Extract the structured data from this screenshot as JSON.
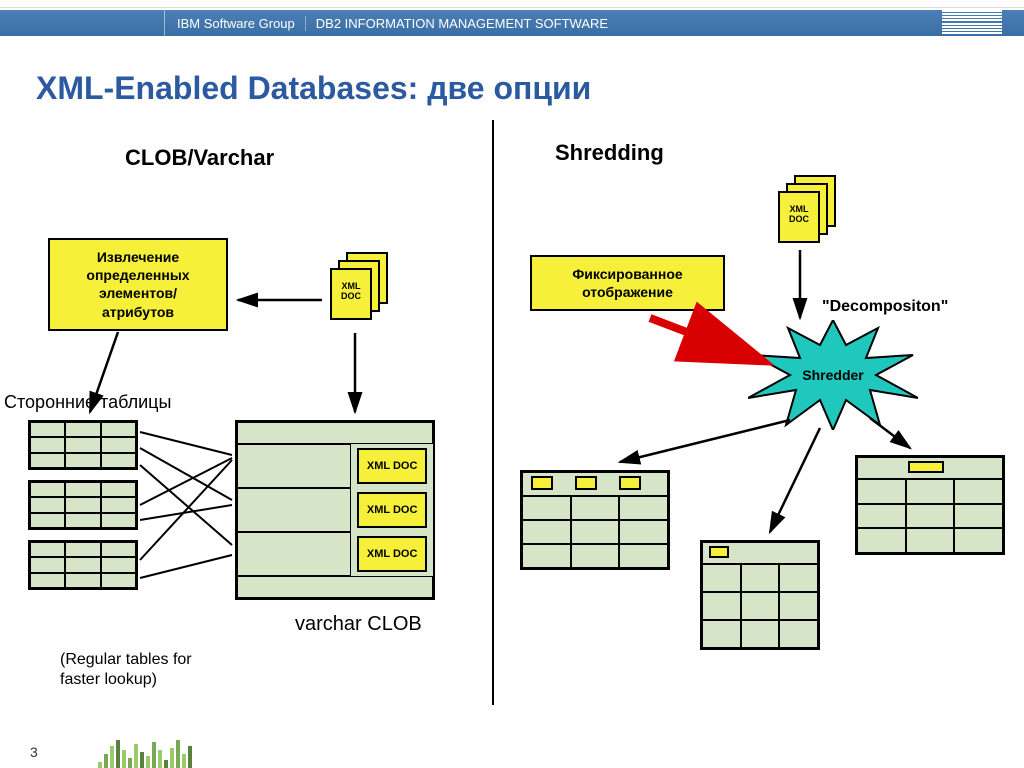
{
  "header": {
    "group": "IBM Software Group",
    "product": "DB2 INFORMATION MANAGEMENT SOFTWARE",
    "logo_text": "IBM"
  },
  "title": "XML-Enabled Databases: две опции",
  "left": {
    "subtitle": "CLOB/Varchar",
    "extract_box": "Извлечение определенных элементов/ атрибутов",
    "xml_doc": "XML DOC",
    "side_tables": "Сторонние таблицы",
    "xml_doc_rows": [
      "XML DOC",
      "XML DOC",
      "XML DOC"
    ],
    "varchar_clob": "varchar CLOB",
    "regular_tables": "(Regular tables for faster lookup)"
  },
  "right": {
    "subtitle": "Shredding",
    "xml_doc": "XML DOC",
    "fixed_mapping": "Фиксированное отображение",
    "decomposition": "\"Decompositon\"",
    "shredder": "Shredder"
  },
  "page_number": "3",
  "colors": {
    "accent": "#2c5aa0",
    "yellow": "#f6f03b",
    "green": "#d6e5c8",
    "teal": "#20c7bd"
  }
}
